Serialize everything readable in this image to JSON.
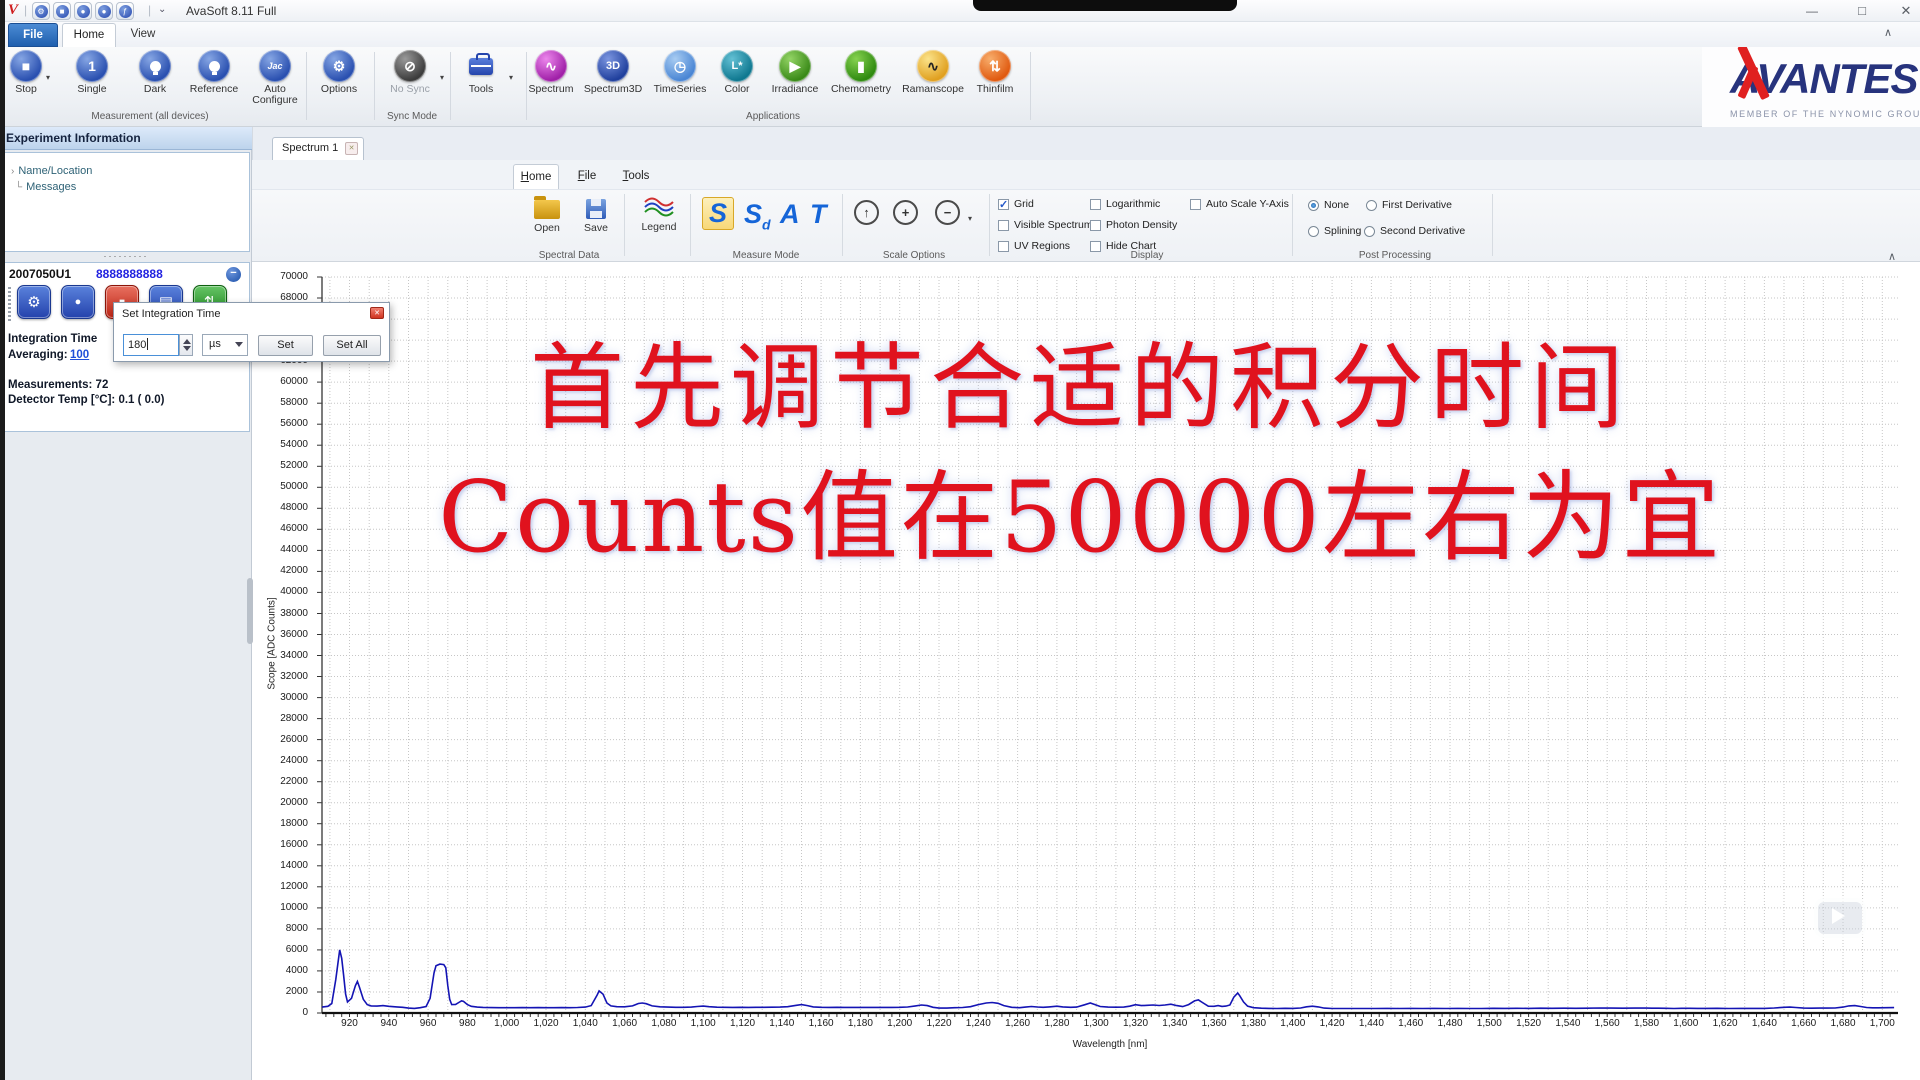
{
  "titlebar": {
    "app_title": "AvaSoft 8.11 Full"
  },
  "main_tabs": {
    "file": "File",
    "home": "Home",
    "view": "View"
  },
  "ribbon": {
    "measurement": {
      "group_label": "Measurement (all devices)",
      "stop": "Stop",
      "single": "Single",
      "dark": "Dark",
      "reference": "Reference",
      "auto_configure": "Auto Configure"
    },
    "options": "Options",
    "sync": {
      "group_label": "Sync Mode",
      "no_sync": "No Sync"
    },
    "tools": "Tools",
    "applications": {
      "group_label": "Applications",
      "spectrum": "Spectrum",
      "spectrum3d": "Spectrum3D",
      "timeseries": "TimeSeries",
      "color": "Color",
      "irradiance": "Irradiance",
      "chemometry": "Chemometry",
      "ramanscope": "Ramanscope",
      "thinfilm": "Thinfilm"
    }
  },
  "logo": {
    "name": "AVANTES",
    "tagline": "MEMBER OF THE NYNOMIC GROUP"
  },
  "sidebar": {
    "experiment_header": "Experiment Information",
    "tree_item1": "Name/Location",
    "tree_item2": "Messages",
    "device": {
      "serial": "2007050U1",
      "code": "8888888888",
      "integration_time_label": "Integration Time",
      "averaging_label": "Averaging:",
      "averaging_value": "100",
      "measurements": "Measurements: 72",
      "detector_temp": "Detector Temp [°C]:   0.1 (  0.0)"
    }
  },
  "dialog": {
    "title": "Set Integration Time",
    "value": "180",
    "unit": "µs",
    "set_button": "Set",
    "set_all_button": "Set All"
  },
  "document": {
    "tab": "Spectrum 1",
    "inner_tabs": {
      "home": "Home",
      "file": "File",
      "tools": "Tools"
    },
    "spectral_data": {
      "group_label": "Spectral Data",
      "open": "Open",
      "save": "Save"
    },
    "legend_label": "Legend",
    "measure_mode": {
      "group_label": "Measure Mode",
      "s": "S",
      "sd_main": "S",
      "sd_sub": "d",
      "a": "A",
      "t": "T",
      "selected": "S"
    },
    "scale_options": {
      "group_label": "Scale Options"
    },
    "display": {
      "group_label": "Display",
      "grid": "Grid",
      "visible_spectrum": "Visible Spectrum",
      "uv_regions": "UV Regions",
      "logarithmic": "Logarithmic",
      "photon_density": "Photon Density",
      "hide_chart": "Hide Chart",
      "auto_scale": "Auto Scale Y-Axis",
      "grid_checked": true
    },
    "post_processing": {
      "group_label": "Post Processing",
      "none": "None",
      "first_derivative": "First Derivative",
      "splining": "Splining",
      "second_derivative": "Second Derivative",
      "selected": "None"
    }
  },
  "overlay": {
    "line1": "首先调节合适的积分时间",
    "line2": "Counts值在50000左右为宜",
    "color": "#e0121e"
  },
  "icons": {
    "logo_v": "V",
    "qat_wrench": "⚙",
    "qat_stop": "■",
    "qat_lamp": "●",
    "qat_lamp2": "●",
    "qat_jac": "ƒ",
    "sep": "|",
    "qat_more": "⌄",
    "minimize": "—",
    "restore": "□",
    "close": "✕",
    "chevron_up": "∧",
    "caret_down": "▾",
    "stop": "■",
    "single": "1",
    "auto_configure": "Jac",
    "wrench": "⚙",
    "no_sync": "⊘",
    "spectrum_wave": "∿",
    "spectrum3d": "3D",
    "timeseries_clock": "◷",
    "color_lab": "L*",
    "irradiance_play": "▶",
    "chemometry_tube": "▮",
    "raman_wave": "∿",
    "thinfilm_arrows": "⇅",
    "tree_expand": "›",
    "tree_branch": "└",
    "collapse_minus": "−",
    "splitter_dots": "·········",
    "gear": "⚙",
    "lamp_dot": "●",
    "red_stop": "■",
    "panel_grid": "▤",
    "green_arrows": "⇅",
    "scale_up": "↑",
    "scale_plus": "+",
    "scale_minus": "−",
    "tab_close": "✕",
    "dialog_close": "✕"
  },
  "chart_data": {
    "type": "line",
    "title": "",
    "xlabel": "Wavelength [nm]",
    "ylabel": "Scope [ADC Counts]",
    "xlim": [
      906,
      1708
    ],
    "ylim": [
      0,
      70000
    ],
    "x_tick_start": 920,
    "x_tick_step": 20,
    "x_tick_end": 1700,
    "y_tick_step": 2000,
    "grid": true,
    "legend_position": "none",
    "line_color": "#1414b4",
    "series": [
      {
        "name": "Scope",
        "points": [
          [
            906,
            560
          ],
          [
            909,
            640
          ],
          [
            911,
            900
          ],
          [
            913,
            3200
          ],
          [
            915,
            6000
          ],
          [
            916,
            5200
          ],
          [
            917,
            3600
          ],
          [
            918,
            1800
          ],
          [
            919,
            1050
          ],
          [
            921,
            1400
          ],
          [
            923,
            2600
          ],
          [
            924,
            3000
          ],
          [
            925,
            2500
          ],
          [
            927,
            1300
          ],
          [
            929,
            800
          ],
          [
            931,
            680
          ],
          [
            934,
            660
          ],
          [
            937,
            700
          ],
          [
            940,
            640
          ],
          [
            944,
            580
          ],
          [
            947,
            540
          ],
          [
            950,
            470
          ],
          [
            953,
            440
          ],
          [
            956,
            500
          ],
          [
            959,
            620
          ],
          [
            961,
            1400
          ],
          [
            963,
            3800
          ],
          [
            964,
            4500
          ],
          [
            966,
            4650
          ],
          [
            968,
            4600
          ],
          [
            969,
            4300
          ],
          [
            970,
            2600
          ],
          [
            971,
            1300
          ],
          [
            972,
            800
          ],
          [
            974,
            820
          ],
          [
            976,
            1050
          ],
          [
            977,
            1150
          ],
          [
            978,
            1100
          ],
          [
            980,
            800
          ],
          [
            982,
            640
          ],
          [
            985,
            560
          ],
          [
            988,
            530
          ],
          [
            992,
            510
          ],
          [
            996,
            500
          ],
          [
            1000,
            505
          ],
          [
            1004,
            500
          ],
          [
            1008,
            510
          ],
          [
            1012,
            500
          ],
          [
            1016,
            515
          ],
          [
            1020,
            505
          ],
          [
            1024,
            500
          ],
          [
            1028,
            510
          ],
          [
            1032,
            505
          ],
          [
            1036,
            520
          ],
          [
            1040,
            560
          ],
          [
            1043,
            700
          ],
          [
            1046,
            1700
          ],
          [
            1047,
            2100
          ],
          [
            1049,
            1800
          ],
          [
            1051,
            950
          ],
          [
            1053,
            680
          ],
          [
            1056,
            600
          ],
          [
            1060,
            590
          ],
          [
            1064,
            680
          ],
          [
            1067,
            900
          ],
          [
            1069,
            950
          ],
          [
            1071,
            880
          ],
          [
            1074,
            680
          ],
          [
            1078,
            590
          ],
          [
            1082,
            560
          ],
          [
            1086,
            545
          ],
          [
            1090,
            545
          ],
          [
            1094,
            560
          ],
          [
            1097,
            620
          ],
          [
            1100,
            660
          ],
          [
            1103,
            600
          ],
          [
            1107,
            550
          ],
          [
            1111,
            540
          ],
          [
            1115,
            535
          ],
          [
            1119,
            545
          ],
          [
            1123,
            535
          ],
          [
            1127,
            545
          ],
          [
            1131,
            540
          ],
          [
            1135,
            555
          ],
          [
            1139,
            565
          ],
          [
            1143,
            600
          ],
          [
            1147,
            720
          ],
          [
            1150,
            800
          ],
          [
            1153,
            700
          ],
          [
            1156,
            580
          ],
          [
            1160,
            545
          ],
          [
            1164,
            535
          ],
          [
            1168,
            545
          ],
          [
            1172,
            530
          ],
          [
            1176,
            535
          ],
          [
            1180,
            530
          ],
          [
            1184,
            535
          ],
          [
            1188,
            530
          ],
          [
            1192,
            528
          ],
          [
            1196,
            532
          ],
          [
            1200,
            545
          ],
          [
            1204,
            570
          ],
          [
            1208,
            680
          ],
          [
            1211,
            760
          ],
          [
            1214,
            700
          ],
          [
            1217,
            540
          ],
          [
            1220,
            470
          ],
          [
            1224,
            465
          ],
          [
            1228,
            500
          ],
          [
            1232,
            520
          ],
          [
            1236,
            600
          ],
          [
            1240,
            800
          ],
          [
            1244,
            950
          ],
          [
            1247,
            1000
          ],
          [
            1250,
            920
          ],
          [
            1253,
            700
          ],
          [
            1257,
            540
          ],
          [
            1261,
            500
          ],
          [
            1264,
            560
          ],
          [
            1267,
            620
          ],
          [
            1270,
            570
          ],
          [
            1273,
            540
          ],
          [
            1276,
            580
          ],
          [
            1280,
            650
          ],
          [
            1283,
            580
          ],
          [
            1287,
            545
          ],
          [
            1290,
            560
          ],
          [
            1294,
            780
          ],
          [
            1297,
            950
          ],
          [
            1299,
            820
          ],
          [
            1302,
            620
          ],
          [
            1306,
            560
          ],
          [
            1310,
            550
          ],
          [
            1314,
            565
          ],
          [
            1317,
            650
          ],
          [
            1320,
            790
          ],
          [
            1323,
            700
          ],
          [
            1326,
            730
          ],
          [
            1329,
            760
          ],
          [
            1332,
            710
          ],
          [
            1335,
            760
          ],
          [
            1338,
            840
          ],
          [
            1341,
            700
          ],
          [
            1344,
            610
          ],
          [
            1347,
            800
          ],
          [
            1350,
            1150
          ],
          [
            1352,
            1250
          ],
          [
            1354,
            1000
          ],
          [
            1357,
            650
          ],
          [
            1360,
            640
          ],
          [
            1362,
            700
          ],
          [
            1364,
            630
          ],
          [
            1366,
            660
          ],
          [
            1368,
            760
          ],
          [
            1370,
            1500
          ],
          [
            1372,
            1900
          ],
          [
            1373,
            1650
          ],
          [
            1375,
            1050
          ],
          [
            1377,
            650
          ],
          [
            1380,
            500
          ],
          [
            1384,
            460
          ],
          [
            1388,
            440
          ],
          [
            1392,
            430
          ],
          [
            1396,
            445
          ],
          [
            1400,
            440
          ],
          [
            1404,
            480
          ],
          [
            1407,
            590
          ],
          [
            1410,
            650
          ],
          [
            1413,
            580
          ],
          [
            1416,
            470
          ],
          [
            1420,
            430
          ],
          [
            1425,
            425
          ],
          [
            1430,
            430
          ],
          [
            1436,
            425
          ],
          [
            1442,
            430
          ],
          [
            1448,
            435
          ],
          [
            1454,
            430
          ],
          [
            1460,
            435
          ],
          [
            1466,
            430
          ],
          [
            1472,
            440
          ],
          [
            1478,
            430
          ],
          [
            1484,
            438
          ],
          [
            1490,
            432
          ],
          [
            1496,
            430
          ],
          [
            1502,
            445
          ],
          [
            1508,
            440
          ],
          [
            1514,
            448
          ],
          [
            1520,
            440
          ],
          [
            1526,
            455
          ],
          [
            1532,
            448
          ],
          [
            1538,
            452
          ],
          [
            1544,
            450
          ],
          [
            1550,
            460
          ],
          [
            1556,
            475
          ],
          [
            1562,
            465
          ],
          [
            1568,
            460
          ],
          [
            1574,
            468
          ],
          [
            1580,
            462
          ],
          [
            1586,
            458
          ],
          [
            1590,
            448
          ],
          [
            1594,
            432
          ],
          [
            1598,
            445
          ],
          [
            1602,
            450
          ],
          [
            1606,
            442
          ],
          [
            1610,
            438
          ],
          [
            1616,
            445
          ],
          [
            1622,
            432
          ],
          [
            1628,
            442
          ],
          [
            1634,
            438
          ],
          [
            1640,
            442
          ],
          [
            1645,
            480
          ],
          [
            1650,
            540
          ],
          [
            1653,
            560
          ],
          [
            1656,
            520
          ],
          [
            1660,
            470
          ],
          [
            1664,
            455
          ],
          [
            1668,
            462
          ],
          [
            1672,
            468
          ],
          [
            1676,
            480
          ],
          [
            1680,
            560
          ],
          [
            1683,
            680
          ],
          [
            1686,
            700
          ],
          [
            1689,
            620
          ],
          [
            1692,
            520
          ],
          [
            1695,
            490
          ],
          [
            1698,
            495
          ],
          [
            1702,
            505
          ],
          [
            1706,
            515
          ]
        ]
      }
    ]
  }
}
